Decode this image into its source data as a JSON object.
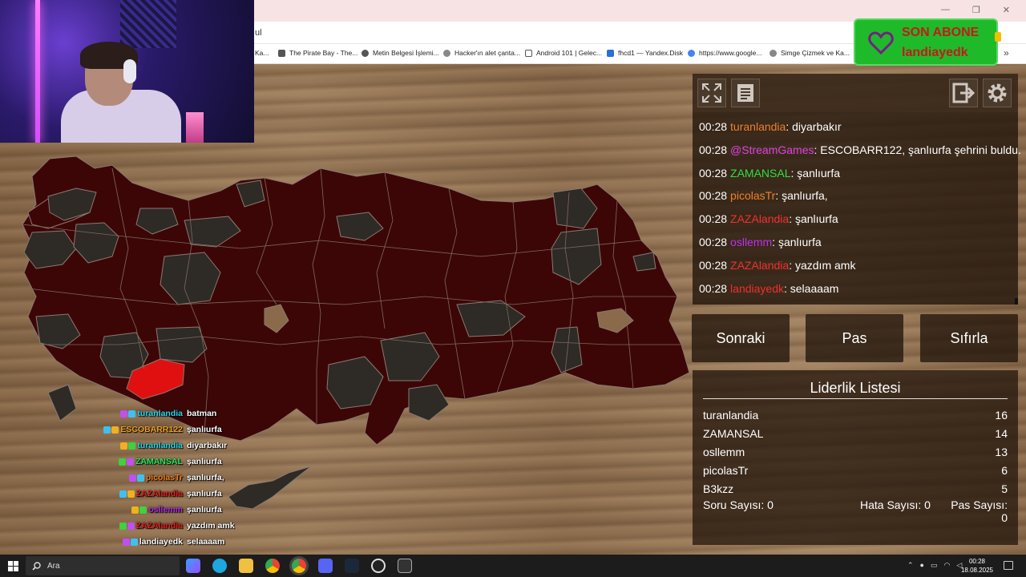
{
  "browser": {
    "address_text": "ul",
    "window_controls": [
      "—",
      "❐",
      "✕"
    ],
    "bookmarks": [
      {
        "label": "Ka...",
        "icon": "bookmark-icon"
      },
      {
        "label": "The Pirate Bay - The...",
        "icon": "ship-icon"
      },
      {
        "label": "Metin Belgesi İşlemi...",
        "icon": "document-icon"
      },
      {
        "label": "Hacker'ın alet çanta...",
        "icon": "globe-icon"
      },
      {
        "label": "Android 101 | Gelec...",
        "icon": "page-icon"
      },
      {
        "label": "fhcd1 — Yandex.Disk",
        "icon": "cloud-icon"
      },
      {
        "label": "https://www.google...",
        "icon": "google-icon"
      },
      {
        "label": "Simge Çizmek ve Ka...",
        "icon": "globe-icon"
      }
    ],
    "more": "»"
  },
  "subscriber": {
    "title": "SON ABONE",
    "name": "landiayedk",
    "accent": "#1fba2a",
    "text_color": "#c41a1a"
  },
  "overlay_chat": [
    {
      "user": "turanlandia",
      "message": "batman",
      "color": "#27d6e8"
    },
    {
      "user": "ESCOBARR122",
      "message": "şanlıurfa",
      "color": "#f0a020"
    },
    {
      "user": "turanlandia",
      "message": "diyarbakır",
      "color": "#27d6e8"
    },
    {
      "user": "ZAMANSAL",
      "message": "şanlıurfa",
      "color": "#27e860"
    },
    {
      "user": "picolasTr",
      "message": "şanlıurfa,",
      "color": "#f08020"
    },
    {
      "user": "ZAZAlandia",
      "message": "şanlıurfa",
      "color": "#e02020"
    },
    {
      "user": "osllemm",
      "message": "şanlıurfa",
      "color": "#b030e0"
    },
    {
      "user": "ZAZAlandia",
      "message": "yazdım amk",
      "color": "#e02020"
    },
    {
      "user": "landiayedk",
      "message": "selaaaam",
      "color": "#ffffff"
    }
  ],
  "chat_log": [
    {
      "time": "00:28",
      "user": "turanlandia",
      "message": ": diyarbakır",
      "color": "#f0802c"
    },
    {
      "time": "00:28",
      "user": "@StreamGames",
      "message": ": ESCOBARR122, şanlıurfa şehrini buldu.",
      "color": "#e040e0"
    },
    {
      "time": "00:28",
      "user": "ZAMANSAL",
      "message": ": şanlıurfa",
      "color": "#30e040"
    },
    {
      "time": "00:28",
      "user": "picolasTr",
      "message": ": şanlıurfa,",
      "color": "#f0802c"
    },
    {
      "time": "00:28",
      "user": "ZAZAlandia",
      "message": ": şanlıurfa",
      "color": "#f03030"
    },
    {
      "time": "00:28",
      "user": "osllemm",
      "message": ": şanlıurfa",
      "color": "#c030f0"
    },
    {
      "time": "00:28",
      "user": "ZAZAlandia",
      "message": ": yazdım amk",
      "color": "#f03030"
    },
    {
      "time": "00:28",
      "user": "landiayedk",
      "message": ": selaaaam",
      "color": "#f03030"
    }
  ],
  "actions": {
    "next": "Sonraki",
    "pass": "Pas",
    "reset": "Sıfırla"
  },
  "leaderboard": {
    "title": "Liderlik Listesi",
    "rows": [
      {
        "name": "turanlandia",
        "score": "16"
      },
      {
        "name": "ZAMANSAL",
        "score": "14"
      },
      {
        "name": "osllemm",
        "score": "13"
      },
      {
        "name": "picolasTr",
        "score": "6"
      },
      {
        "name": "B3kzz",
        "score": "5"
      }
    ],
    "stats": {
      "question_label": "Soru Sayısı:",
      "question_value": "0",
      "error_label": "Hata Sayısı:",
      "error_value": "0",
      "pass_label": "Pas Sayısı:",
      "pass_value": "0"
    }
  },
  "map": {
    "province_fill": "#3d0606",
    "found_fill": "#2e2a26",
    "highlight_fill": "#e01010"
  },
  "taskbar": {
    "search_placeholder": "Ara",
    "time": "00:28",
    "date": "18.08.2025",
    "tray_icons": [
      "chevron-up-icon",
      "microphone-icon",
      "keyboard-icon",
      "wifi-icon",
      "volume-icon"
    ]
  }
}
